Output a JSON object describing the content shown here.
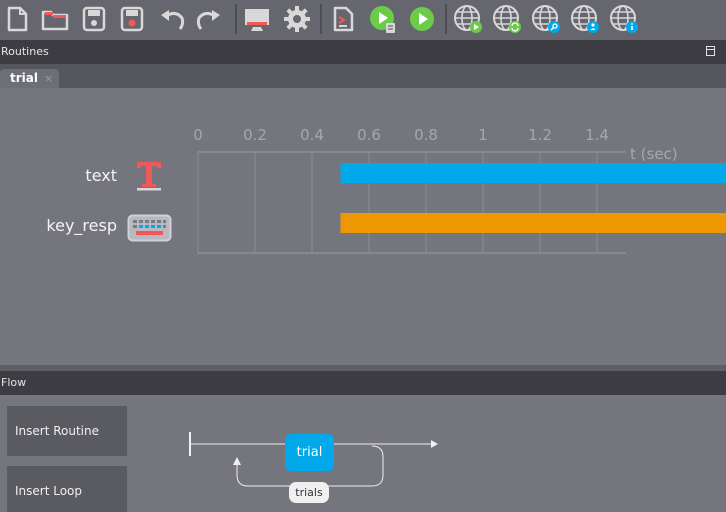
{
  "toolbar": {
    "buttons": [
      {
        "icon": "new-file-icon"
      },
      {
        "icon": "open-folder-icon"
      },
      {
        "icon": "save-icon"
      },
      {
        "icon": "save-as-icon"
      },
      {
        "icon": "undo-icon"
      },
      {
        "icon": "redo-icon"
      },
      {
        "icon": "monitor-icon"
      },
      {
        "icon": "settings-gear-icon"
      },
      {
        "icon": "compile-script-icon"
      },
      {
        "icon": "run-pilot-icon"
      },
      {
        "icon": "run-icon"
      },
      {
        "icon": "globe-run-online-icon"
      },
      {
        "icon": "globe-sync-icon"
      },
      {
        "icon": "globe-search-icon"
      },
      {
        "icon": "globe-login-icon"
      },
      {
        "icon": "globe-info-icon"
      }
    ]
  },
  "routines": {
    "header": "Routines",
    "tabs": [
      {
        "label": "trial",
        "close": "×"
      }
    ],
    "timeline": {
      "ticks": [
        "0",
        "0.2",
        "0.4",
        "0.6",
        "0.8",
        "1",
        "1.2",
        "1.4"
      ],
      "tick_values": [
        0,
        0.2,
        0.4,
        0.6,
        0.8,
        1,
        1.2,
        1.4
      ],
      "axis_label": "t (sec)",
      "components": [
        {
          "name": "text",
          "icon": "text-component-icon",
          "start": 0.5,
          "color": "#02a9ea"
        },
        {
          "name": "key_resp",
          "icon": "keyboard-component-icon",
          "start": 0.5,
          "color": "#ec9703"
        }
      ]
    }
  },
  "flow": {
    "header": "Flow",
    "insert_routine": "Insert Routine",
    "insert_loop": "Insert Loop",
    "routine": "trial",
    "loop": "trials",
    "routine_color": "#02a9ea"
  }
}
